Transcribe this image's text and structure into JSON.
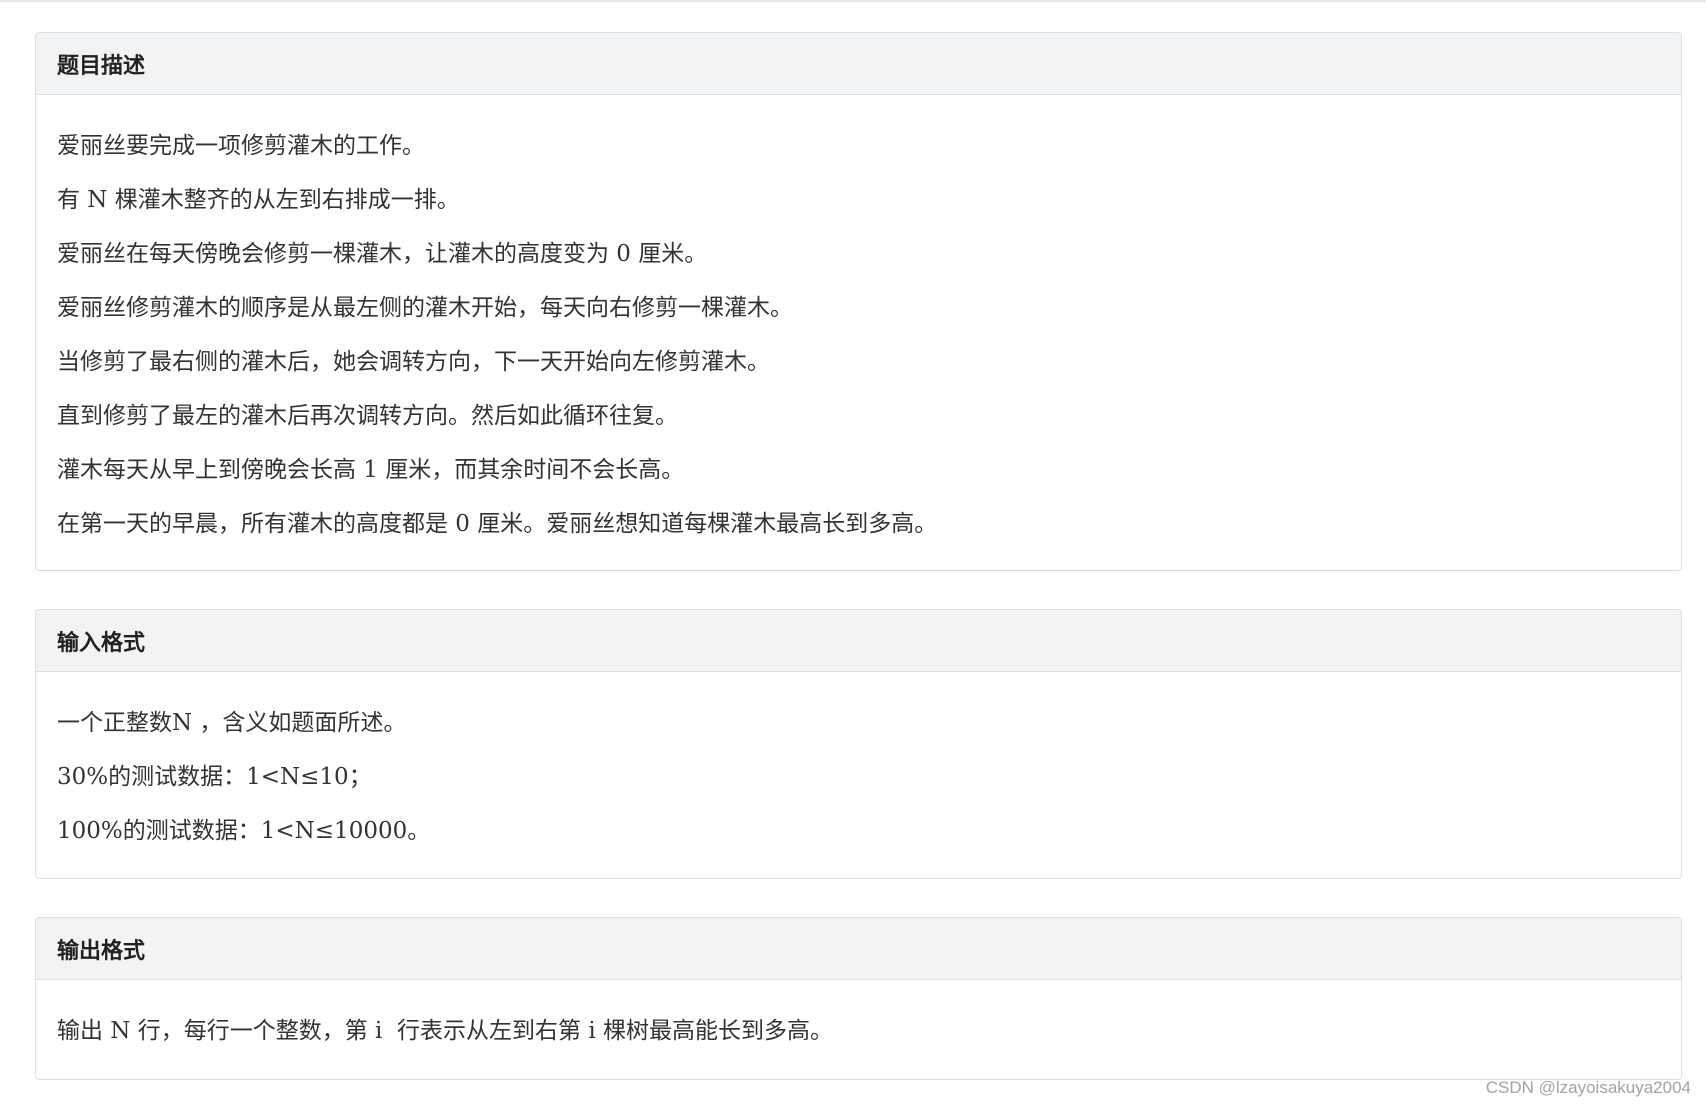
{
  "sections": {
    "description": {
      "title": "题目描述",
      "lines": [
        "爱丽丝要完成一项修剪灌木的工作。",
        "有 N 棵灌木整齐的从左到右排成一排。",
        "爱丽丝在每天傍晚会修剪一棵灌木，让灌木的高度变为 0 厘米。",
        "爱丽丝修剪灌木的顺序是从最左侧的灌木开始，每天向右修剪一棵灌木。",
        "当修剪了最右侧的灌木后，她会调转方向，下一天开始向左修剪灌木。",
        "直到修剪了最左的灌木后再次调转方向。然后如此循环往复。",
        "灌木每天从早上到傍晚会长高 1 厘米，而其余时间不会长高。",
        "在第一天的早晨，所有灌木的高度都是 0 厘米。爱丽丝想知道每棵灌木最高长到多高。"
      ]
    },
    "input": {
      "title": "输入格式",
      "lines": [
        "一个正整数N ，含义如题面所述。",
        "30%的测试数据：1<N≤10；",
        "100%的测试数据：1<N≤10000。"
      ]
    },
    "output": {
      "title": "输出格式",
      "lines": [
        "输出 N 行，每行一个整数，第 i  行表示从左到右第 i 棵树最高能长到多高。"
      ]
    }
  },
  "watermark": "CSDN @lzayoisakuya2004"
}
